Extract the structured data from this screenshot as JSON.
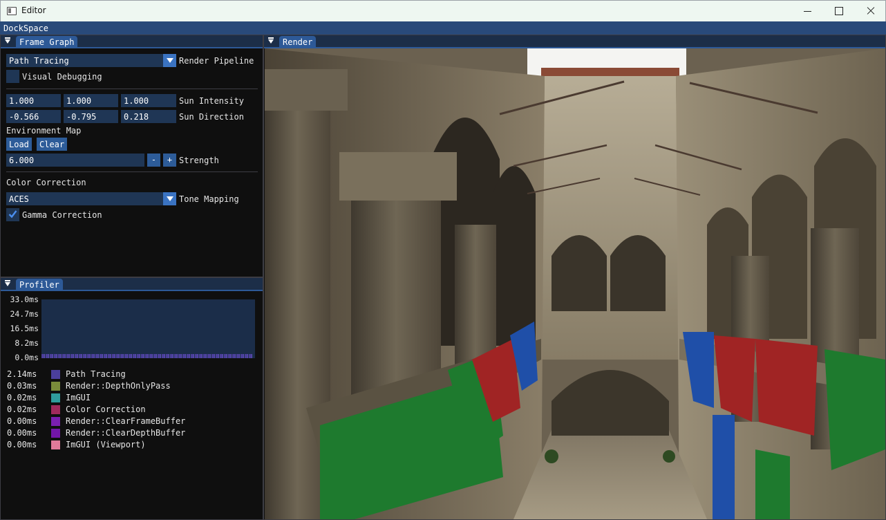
{
  "window": {
    "title": "Editor",
    "icon": "window-app-icon"
  },
  "dockspace": {
    "label": "DockSpace"
  },
  "frame_graph": {
    "tab_label": "Frame Graph",
    "pipeline": {
      "value": "Path Tracing",
      "label": "Render Pipeline"
    },
    "visual_debugging": {
      "label": "Visual Debugging",
      "checked": false
    },
    "sun_intensity": {
      "values": [
        "1.000",
        "1.000",
        "1.000"
      ],
      "label": "Sun Intensity"
    },
    "sun_direction": {
      "values": [
        "-0.566",
        "-0.795",
        "0.218"
      ],
      "label": "Sun Direction"
    },
    "environment_map": {
      "label": "Environment Map",
      "load_label": "Load",
      "clear_label": "Clear"
    },
    "strength": {
      "value": "6.000",
      "minus": "-",
      "plus": "+",
      "label": "Strength"
    },
    "color_correction": {
      "label": "Color Correction"
    },
    "tone_mapping": {
      "value": "ACES",
      "label": "Tone Mapping"
    },
    "gamma_correction": {
      "label": "Gamma Correction",
      "checked": true
    }
  },
  "profiler": {
    "tab_label": "Profiler",
    "y_labels": [
      "33.0ms",
      "24.7ms",
      "16.5ms",
      "8.2ms",
      "0.0ms"
    ],
    "entries": [
      {
        "time": "2.14ms",
        "name": "Path Tracing",
        "color": "#4b3f9c"
      },
      {
        "time": "0.03ms",
        "name": "Render::DepthOnlyPass",
        "color": "#7a8c3a"
      },
      {
        "time": "0.02ms",
        "name": "ImGUI",
        "color": "#2f9c9c"
      },
      {
        "time": "0.02ms",
        "name": "Color Correction",
        "color": "#a02a5c"
      },
      {
        "time": "0.00ms",
        "name": "Render::ClearFrameBuffer",
        "color": "#7a1fb0"
      },
      {
        "time": "0.00ms",
        "name": "Render::ClearDepthBuffer",
        "color": "#7216a8"
      },
      {
        "time": "0.00ms",
        "name": "ImGUI (Viewport)",
        "color": "#e07a9a"
      }
    ]
  },
  "render": {
    "tab_label": "Render"
  },
  "colors": {
    "accent": "#2d5997",
    "frame_bg": "#1f3655",
    "window_bg": "#0f0f0f"
  }
}
